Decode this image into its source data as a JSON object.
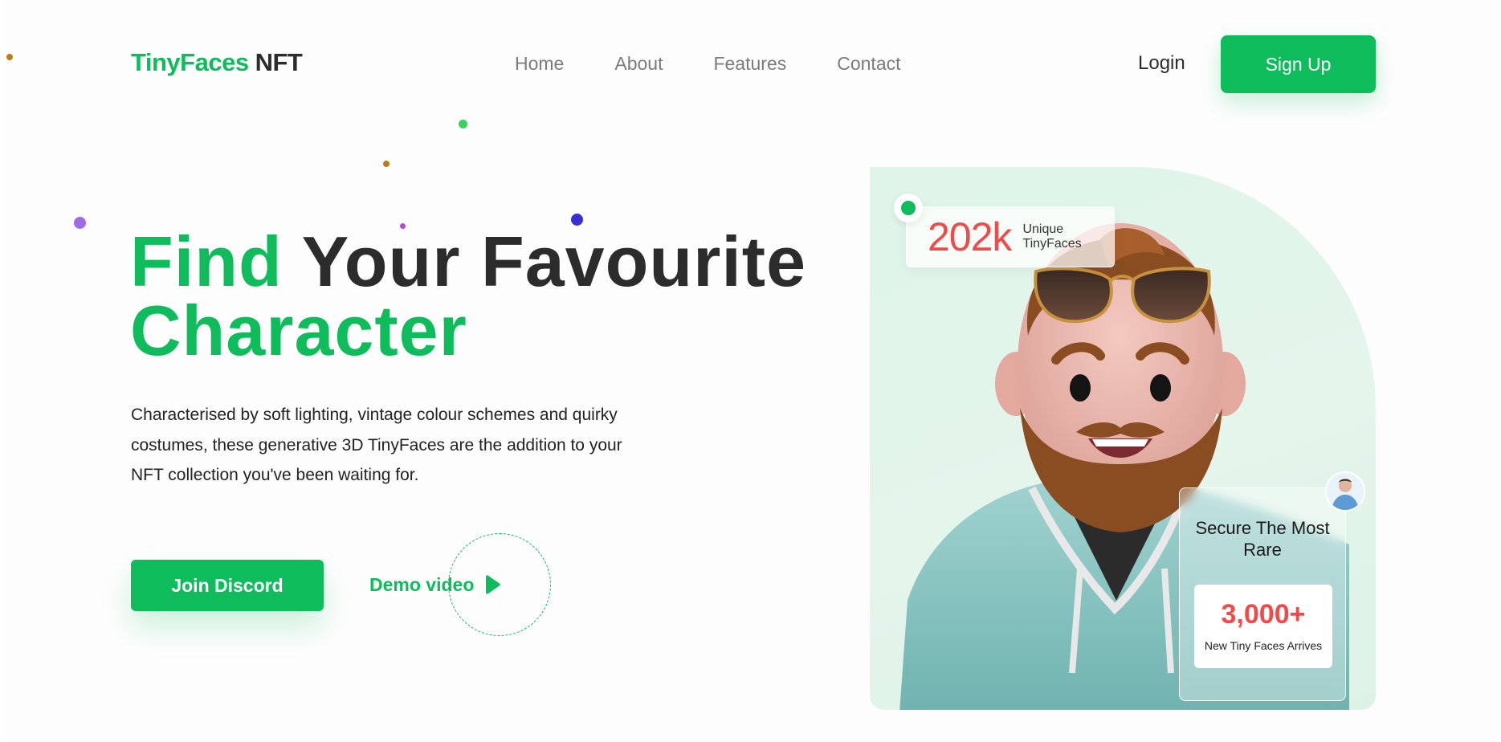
{
  "header": {
    "logo_primary": "TinyFaces",
    "logo_secondary": "NFT",
    "nav": [
      {
        "label": "Home"
      },
      {
        "label": "About"
      },
      {
        "label": "Features"
      },
      {
        "label": "Contact"
      }
    ],
    "login_label": "Login",
    "signup_label": "Sign Up"
  },
  "hero": {
    "headline_green_1": "Find",
    "headline_dark": "Your Favourite",
    "headline_green_2": "Character",
    "description": "Characterised by soft lighting, vintage colour schemes and quirky costumes, these generative 3D TinyFaces are the addition to your NFT collection you've been waiting for.",
    "join_label": "Join Discord",
    "demo_label": "Demo video"
  },
  "card": {
    "stat_value": "202k",
    "stat_label": "Unique TinyFaces",
    "rare_title": "Secure The Most Rare",
    "rare_count": "3,000+",
    "rare_sub": "New Tiny Faces Arrives"
  },
  "colors": {
    "accent": "#0ebc5c",
    "text_dark": "#2c2c2c",
    "highlight_red": "#f04a4a",
    "card_bg": "#dff5e8"
  },
  "icons": {
    "play": "play-icon",
    "status": "status-dot-icon",
    "avatar": "avatar-icon"
  }
}
